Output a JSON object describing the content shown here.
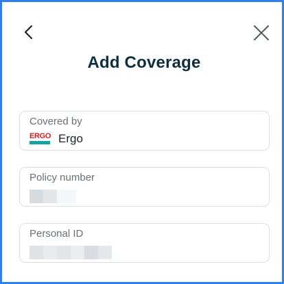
{
  "header": {
    "title": "Add Coverage",
    "back_icon": "chevron-left-icon",
    "close_icon": "close-icon"
  },
  "fields": {
    "covered_by": {
      "label": "Covered by",
      "value": "Ergo",
      "logo_text": "ERGO"
    },
    "policy_number": {
      "label": "Policy number",
      "value_state": "redacted"
    },
    "personal_id": {
      "label": "Personal ID",
      "value_state": "redacted"
    }
  },
  "colors": {
    "frame_border": "#2f80ed",
    "title": "#0f2d3f",
    "field_border": "#d9dee2",
    "label": "#6b6f73",
    "logo_red": "#d21f1f",
    "logo_teal": "#14a3a0"
  }
}
